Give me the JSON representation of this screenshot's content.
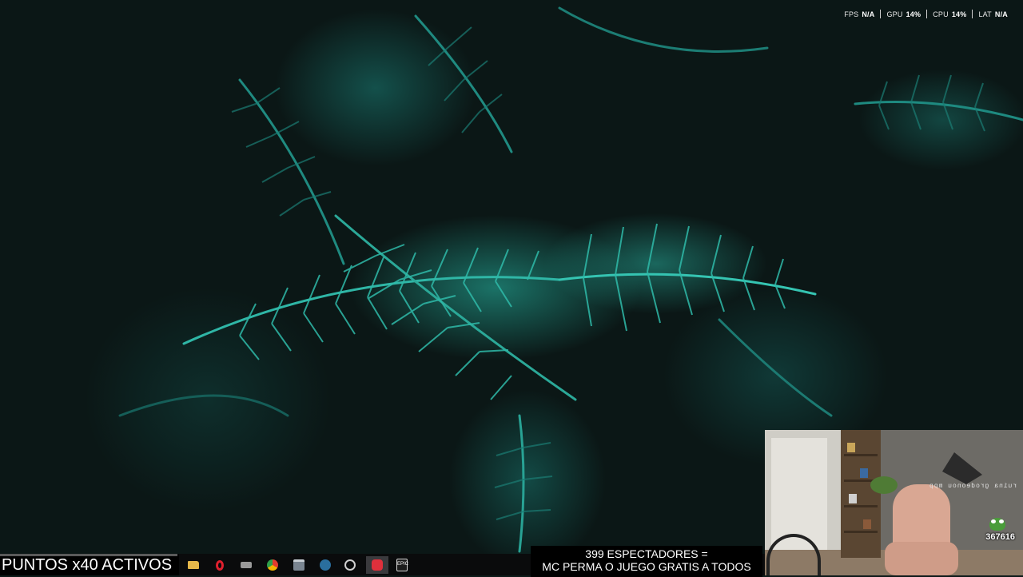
{
  "performance_overlay": {
    "items": [
      {
        "label": "FPS",
        "value": "N/A"
      },
      {
        "label": "GPU",
        "value": "14%"
      },
      {
        "label": "CPU",
        "value": "14%"
      },
      {
        "label": "LAT",
        "value": "N/A"
      }
    ]
  },
  "stream_overlay": {
    "points_banner": "PUNTOS x40 ACTIVOS",
    "viewers_line1": "399 ESPECTADORES =",
    "viewers_line2": "MC PERMA O JUEGO GRATIS A TODOS"
  },
  "webcam": {
    "mirrored_text": "ruina grodeonou mpp",
    "counter": "367616"
  },
  "taskbar": {
    "apps": [
      {
        "name": "file-explorer-icon",
        "color": "#e6b84a",
        "active": false
      },
      {
        "name": "opera-icon",
        "color": "#e0202e",
        "active": false
      },
      {
        "name": "launcher-icon",
        "color": "#9a9a9a",
        "active": false
      },
      {
        "name": "chrome-icon",
        "color": "#2e9f4b",
        "active": false
      },
      {
        "name": "window-icon",
        "color": "#7a8591",
        "active": false
      },
      {
        "name": "steam-icon",
        "color": "#2a6f9e",
        "active": false
      },
      {
        "name": "obs-icon",
        "color": "#cfcfcf",
        "active": false
      },
      {
        "name": "record-icon",
        "color": "#e0303c",
        "active": true
      },
      {
        "name": "epic-games-icon",
        "color": "#d6d6d6",
        "active": false
      }
    ],
    "epic_label": "EPIC"
  }
}
